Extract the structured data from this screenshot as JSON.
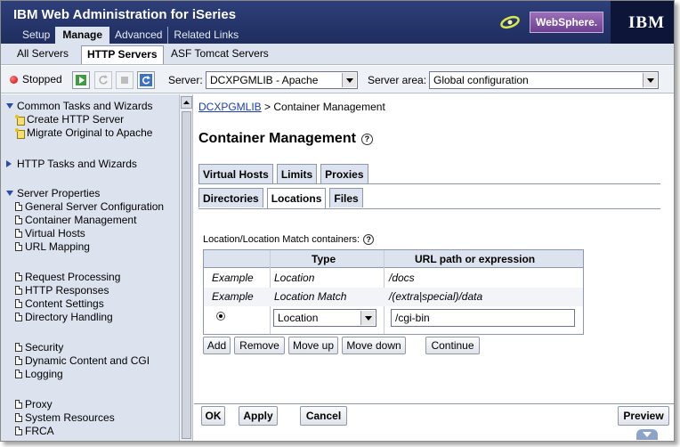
{
  "app": {
    "title": "IBM Web Administration for iSeries",
    "top_tabs": [
      "Setup",
      "Manage",
      "Advanced",
      "Related Links"
    ],
    "active_top_tab": "Manage",
    "websphere_label": "WebSphere.",
    "ibm_logo": "IBM"
  },
  "sub_tabs": {
    "all_servers": "All Servers",
    "http_servers": "HTTP Servers",
    "asf_tomcat": "ASF Tomcat Servers",
    "active": "HTTP Servers"
  },
  "toolbar": {
    "status": "Stopped",
    "server_label": "Server:",
    "server_value": "DCXPGMLIB - Apache",
    "server_area_label": "Server area:",
    "server_area_value": "Global configuration",
    "icons": [
      "start-icon",
      "restart-icon",
      "stop-icon",
      "refresh-icon"
    ]
  },
  "nav": {
    "common_tasks": "Common Tasks and Wizards",
    "create_http": "Create HTTP Server",
    "migrate": "Migrate Original to Apache",
    "http_tasks": "HTTP Tasks and Wizards",
    "server_properties": "Server Properties",
    "items": [
      "General Server Configuration",
      "Container Management",
      "Virtual Hosts",
      "URL Mapping",
      "Request Processing",
      "HTTP Responses",
      "Content Settings",
      "Directory Handling",
      "Security",
      "Dynamic Content and CGI",
      "Logging",
      "Proxy",
      "System Resources",
      "FRCA"
    ]
  },
  "main": {
    "breadcrumb_link": "DCXPGMLIB",
    "breadcrumb_rest": " > Container Management",
    "title": "Container Management",
    "tabs_row1": [
      "Virtual Hosts",
      "Limits",
      "Proxies"
    ],
    "tabs_row2": [
      "Directories",
      "Locations",
      "Files"
    ],
    "active_tab": "Locations",
    "section_label": "Location/Location Match containers:",
    "table": {
      "headers": [
        "Type",
        "URL path or expression"
      ],
      "rows": [
        {
          "label": "Example",
          "type": "Location",
          "url": "/docs"
        },
        {
          "label": "Example",
          "type": "Location Match",
          "url": "/(extra|special)/data"
        }
      ],
      "edit_row": {
        "type": "Location",
        "url": "/cgi-bin"
      }
    },
    "buttons": {
      "add": "Add",
      "remove": "Remove",
      "move_up": "Move up",
      "move_down": "Move down",
      "continue": "Continue"
    },
    "footer": {
      "ok": "OK",
      "apply": "Apply",
      "cancel": "Cancel",
      "preview": "Preview"
    }
  }
}
